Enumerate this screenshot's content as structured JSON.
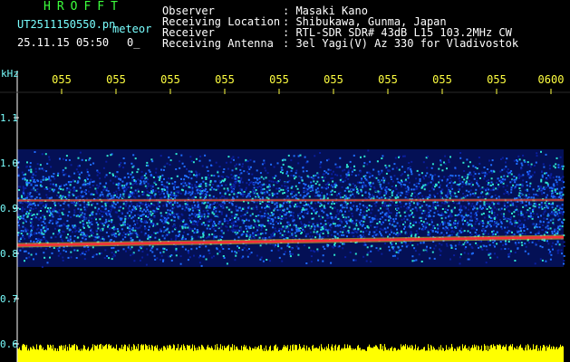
{
  "header": {
    "brand": "HROFFT",
    "filename": "UT2511150550.pn",
    "mode": "meteor",
    "datetime": "25.11.15 05:50",
    "extra": "0_",
    "info": [
      {
        "label": "Observer",
        "value": ": Masaki Kano"
      },
      {
        "label": "Receiving Location",
        "value": ": Shibukawa, Gunma, Japan"
      },
      {
        "label": "Receiver",
        "value": ": RTL-SDR SDR# 43dB L15 103.2MHz CW"
      },
      {
        "label": "Receiving Antenna",
        "value": ": 3el Yagi(V) Az 330 for Vladivostok"
      }
    ]
  },
  "colors": {
    "background": "#000000",
    "label": "#79ffff",
    "time_label": "#ffff40",
    "brand": "#3cff3c",
    "noise_low": "#0a1f9e",
    "noise_mid": "#1f6dff",
    "noise_high": "#2ee6d0",
    "trace": "#ff2a3a",
    "trace_glow": "#ffd21f",
    "amplitude": "#ffff00"
  },
  "chart_data": {
    "type": "heatmap",
    "ylabel": "kHz",
    "y_ticks": [
      "1.1",
      "1.0",
      "0.9",
      "0.8",
      "0.7",
      "0.6"
    ],
    "y_tick_values": [
      1.1,
      1.0,
      0.9,
      0.8,
      0.7,
      0.6
    ],
    "ylim": [
      0.6,
      1.1
    ],
    "x_ticks": [
      "055",
      "055",
      "055",
      "055",
      "055",
      "055",
      "055",
      "055",
      "055",
      "0600"
    ],
    "noise_band_khz": [
      0.77,
      1.03
    ],
    "traces": [
      {
        "start_khz": 0.917,
        "end_khz": 0.918,
        "intensity": "weak"
      },
      {
        "start_khz": 0.818,
        "end_khz": 0.836,
        "intensity": "strong"
      }
    ],
    "grid": true
  }
}
